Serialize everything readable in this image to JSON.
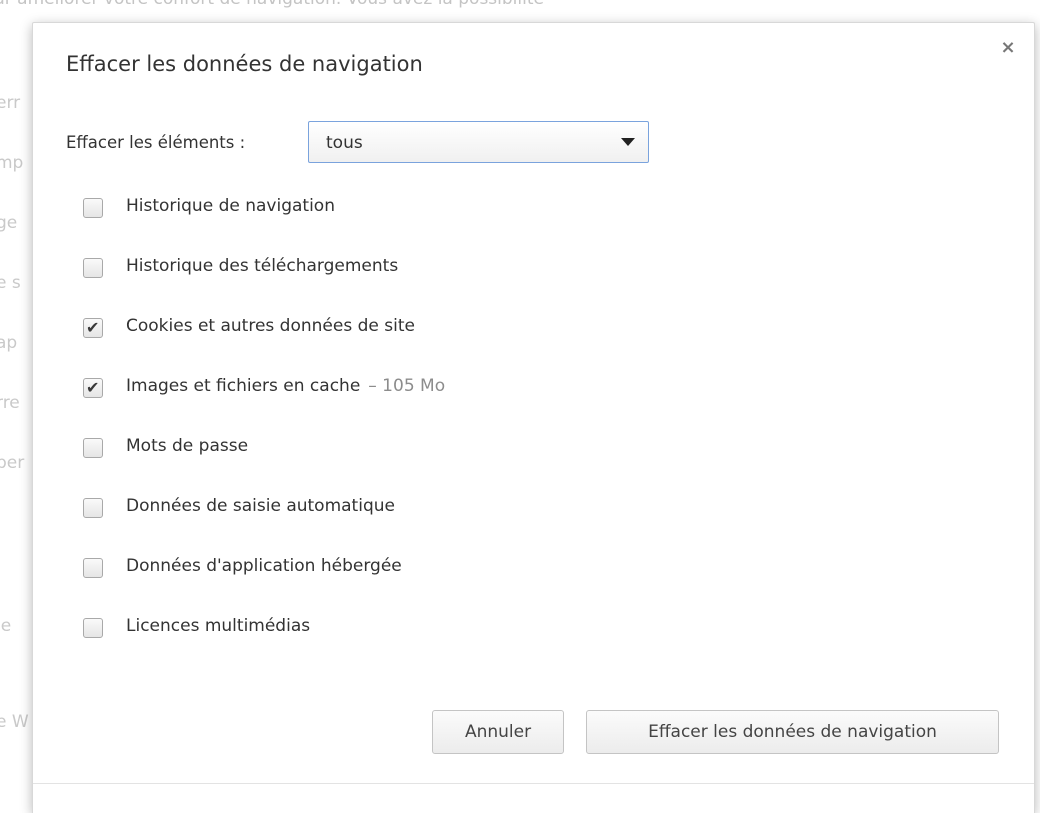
{
  "background": {
    "top_text": "ur améliorer votre confort de navigation. Vous avez la possibilité",
    "fragments": [
      "err",
      "mp",
      "ge",
      "e s",
      "ap",
      "rre",
      "per",
      "le",
      "e W"
    ]
  },
  "dialog": {
    "title": "Effacer les données de navigation",
    "close_symbol": "×",
    "period": {
      "label": "Effacer les éléments :",
      "selected": "tous"
    },
    "options": [
      {
        "label": "Historique de navigation",
        "checked": false
      },
      {
        "label": "Historique des téléchargements",
        "checked": false
      },
      {
        "label": "Cookies et autres données de site",
        "checked": true
      },
      {
        "label": "Images et fichiers en cache",
        "extra": "– 105 Mo",
        "checked": true
      },
      {
        "label": "Mots de passe",
        "checked": false
      },
      {
        "label": "Données de saisie automatique",
        "checked": false
      },
      {
        "label": "Données d'application hébergée",
        "checked": false
      },
      {
        "label": "Licences multimédias",
        "checked": false
      }
    ],
    "check_symbol": "✔",
    "buttons": {
      "cancel": "Annuler",
      "confirm": "Effacer les données de navigation"
    }
  }
}
